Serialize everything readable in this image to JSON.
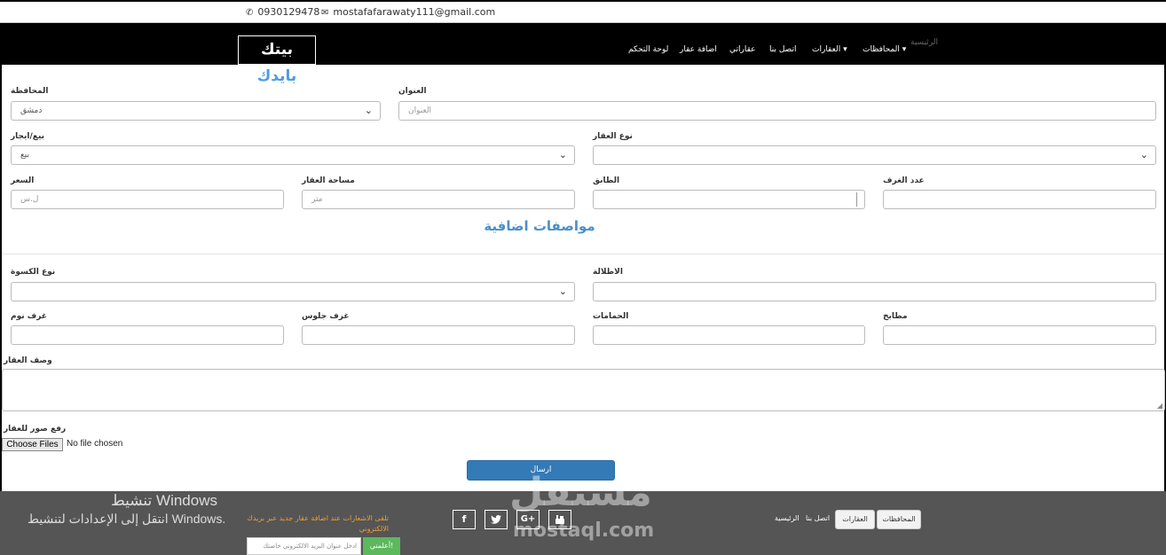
{
  "contact": {
    "phone": "0930129478",
    "email": "mostafafarawaty111@gmail.com"
  },
  "brand": {
    "part1": "بيتك",
    "part2": "بايدك"
  },
  "nav": {
    "items": [
      {
        "label": "لوحة التحكم"
      },
      {
        "label": "اضافة عقار"
      },
      {
        "label": "عقاراتي"
      },
      {
        "label": "اتصل بنا"
      },
      {
        "label": "العقارات ▾"
      },
      {
        "label": "المحافظات ▾"
      },
      {
        "label": "الرئيسية"
      }
    ]
  },
  "form": {
    "governorate": {
      "label": "المحافظة",
      "value": "دمشق"
    },
    "address": {
      "label": "العنوان",
      "placeholder": "العنوان"
    },
    "sale_rent": {
      "label": "بيع/ايجار",
      "value": "بيع"
    },
    "property_type": {
      "label": "نوع العقار",
      "value": ""
    },
    "price": {
      "label": "السعر",
      "placeholder": "ل.س"
    },
    "area": {
      "label": "مساحة العقار",
      "placeholder": "متر"
    },
    "floor": {
      "label": "الطابق",
      "value": ""
    },
    "rooms": {
      "label": "عدد الغرف",
      "value": ""
    },
    "section_title": "مواصفات اضافية",
    "finishing": {
      "label": "نوع الكسوة",
      "value": ""
    },
    "view": {
      "label": "الاطلالة",
      "value": ""
    },
    "bedrooms": {
      "label": "غرف نوم",
      "value": ""
    },
    "living_rooms": {
      "label": "غرف جلوس",
      "value": ""
    },
    "bathrooms": {
      "label": "الحمامات",
      "value": ""
    },
    "kitchens": {
      "label": "مطابخ",
      "value": ""
    },
    "description": {
      "label": "وصف العقار"
    },
    "upload": {
      "label": "رفع صور للعقار",
      "button": "Choose Files",
      "status": "No file chosen"
    },
    "submit": "ارسال"
  },
  "footer": {
    "links": [
      "المحافظات",
      "العقارات",
      "اتصل بنا",
      "الرئيسية"
    ],
    "social": [
      "f",
      "t",
      "G+",
      "yt"
    ],
    "notify_text": "تلقى الاشعارات عند اضافة عقار جديد عبر بريدك الالكتروني",
    "email_placeholder": "ادخل عنوان البريد الالكتروني خاصتك",
    "notify_button": "أعلمني!"
  },
  "overlay": {
    "windows_title": "تنشيط Windows",
    "windows_sub": "انتقل إلى الإعدادات لتنشيط Windows.",
    "watermark_ar": "مستقل",
    "watermark_en": "mostaql.com"
  }
}
